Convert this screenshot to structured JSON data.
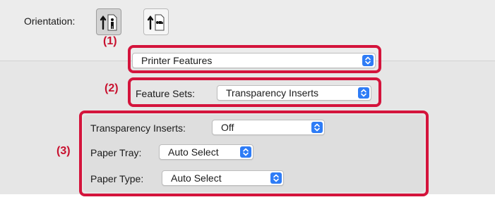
{
  "orientation": {
    "label": "Orientation:",
    "options": [
      {
        "name": "portrait",
        "selected": true
      },
      {
        "name": "landscape",
        "selected": false
      }
    ]
  },
  "callouts": {
    "one": "(1)",
    "two": "(2)",
    "three": "(3)"
  },
  "panel_selector": {
    "value": "Printer Features"
  },
  "feature_sets": {
    "label": "Feature Sets:",
    "value": "Transparency Inserts"
  },
  "options": {
    "transparency_inserts": {
      "label": "Transparency Inserts:",
      "value": "Off"
    },
    "paper_tray": {
      "label": "Paper Tray:",
      "value": "Auto Select"
    },
    "paper_type": {
      "label": "Paper Type:",
      "value": "Auto Select"
    }
  },
  "colors": {
    "highlight_red": "#d4143c",
    "stepper_blue": "#2e7cf6"
  }
}
